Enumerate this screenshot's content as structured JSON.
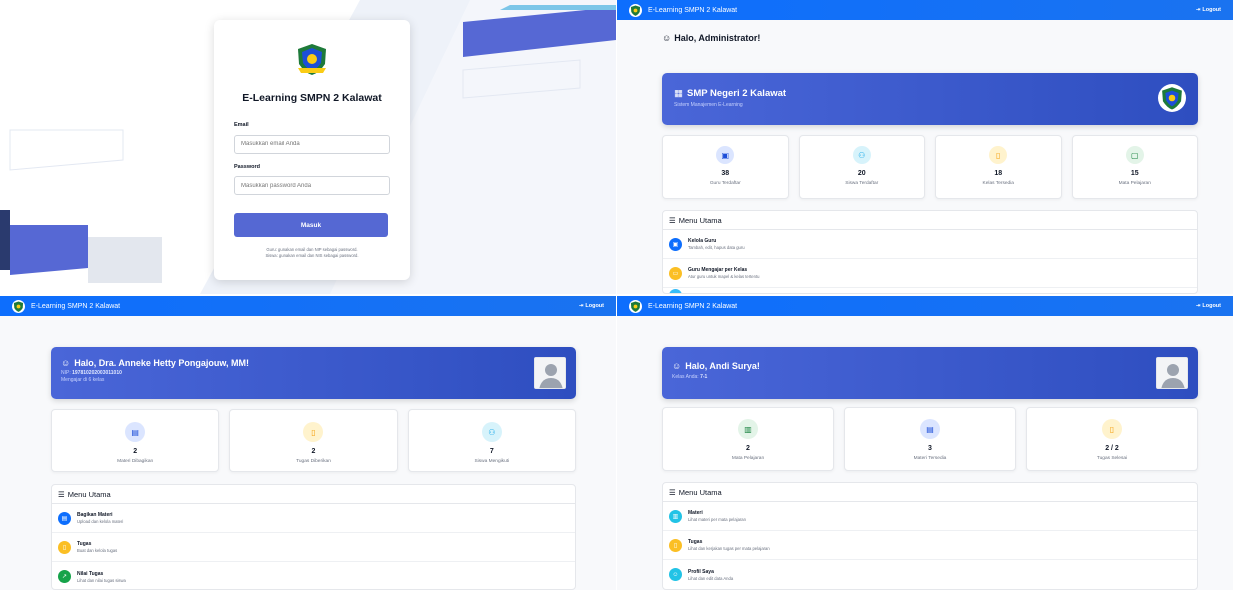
{
  "colors": {
    "primary": "#0d6efd",
    "hero": "#3b5bd2",
    "login_btn": "#5568d3"
  },
  "login": {
    "title": "E-Learning SMPN 2 Kalawat",
    "email_label": "Email",
    "email_placeholder": "Masukkan email Anda",
    "password_label": "Password",
    "password_placeholder": "Masukkan password Anda",
    "submit_label": "Masuk",
    "note_line1": "Guru: gunakan email dan NIP sebagai password.",
    "note_line2": "Siswa: gunakan email dan NIS sebagai password."
  },
  "navbar": {
    "brand": "E-Learning SMPN 2 Kalawat",
    "logout": "Logout"
  },
  "admin": {
    "greeting": "Halo, Administrator!",
    "hero_title": "SMP Negeri 2 Kalawat",
    "hero_subtitle": "Sistem Manajemen E-Learning",
    "stats": [
      {
        "value": "38",
        "label": "Guru Terdaftar",
        "icon": "teacher-icon"
      },
      {
        "value": "20",
        "label": "Siswa Terdaftar",
        "icon": "users-icon"
      },
      {
        "value": "18",
        "label": "Kelas Tersedia",
        "icon": "door-icon"
      },
      {
        "value": "15",
        "label": "Mata Pelajaran",
        "icon": "book-icon"
      }
    ],
    "menu_title": "Menu Utama",
    "menu": [
      {
        "title": "Kelola Guru",
        "desc": "Tambah, edit, hapus data guru"
      },
      {
        "title": "Guru Mengajar per Kelas",
        "desc": "Atur guru untuk mapel & kelas tertentu"
      }
    ]
  },
  "teacher": {
    "greeting": "Halo, Dra. Anneke Hetty Pongajouw, MM!",
    "nip_label": "NIP:",
    "nip": "197810202003011010",
    "subline": "Mengajar di 6 kelas",
    "stats": [
      {
        "value": "2",
        "label": "Materi Dibagikan"
      },
      {
        "value": "2",
        "label": "Tugas Diberikan"
      },
      {
        "value": "7",
        "label": "Siswa Mengikuti"
      }
    ],
    "menu_title": "Menu Utama",
    "menu": [
      {
        "title": "Bagikan Materi",
        "desc": "Upload dan kelola materi"
      },
      {
        "title": "Tugas",
        "desc": "Buat dan kelola tugas"
      },
      {
        "title": "Nilai Tugas",
        "desc": "Lihat dan nilai tugas siswa"
      }
    ]
  },
  "student": {
    "greeting": "Halo, Andi Surya!",
    "class_label": "Kelas Anda:",
    "class_value": "7-1",
    "stats": [
      {
        "value": "2",
        "label": "Mata Pelajaran"
      },
      {
        "value": "3",
        "label": "Materi Tersedia"
      },
      {
        "value": "2 / 2",
        "label": "Tugas Selesai"
      }
    ],
    "menu_title": "Menu Utama",
    "menu": [
      {
        "title": "Materi",
        "desc": "Lihat materi per mata pelajaran"
      },
      {
        "title": "Tugas",
        "desc": "Lihat dan kerjakan tugas per mata pelajaran"
      },
      {
        "title": "Profil Saya",
        "desc": "Lihat dan edit data Anda"
      }
    ]
  }
}
